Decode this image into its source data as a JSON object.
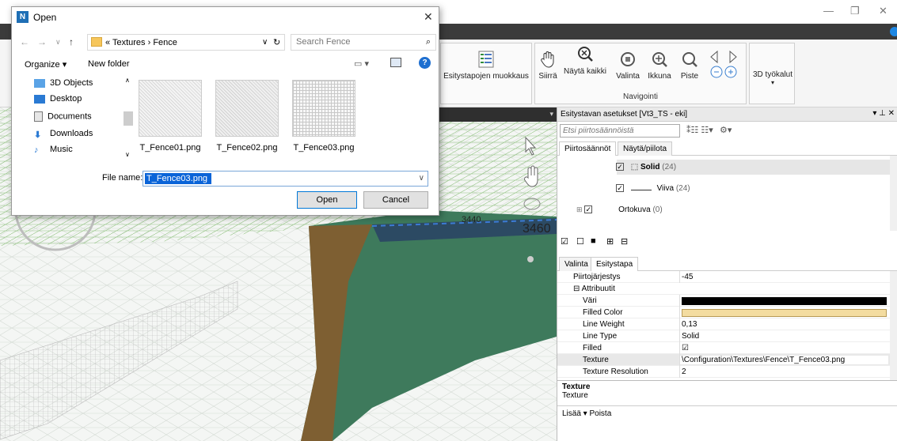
{
  "dialog": {
    "title": "Open",
    "app_icon_letter": "N",
    "breadcrumb": "« Textures › Fence",
    "search_placeholder": "Search Fence",
    "organize_label": "Organize ▾",
    "new_folder_label": "New folder",
    "nav_items": [
      "3D Objects",
      "Desktop",
      "Documents",
      "Downloads",
      "Music"
    ],
    "files": [
      "T_Fence01.png",
      "T_Fence02.png",
      "T_Fence03.png"
    ],
    "file_name_label": "File name:",
    "file_name_value": "T_Fence03.png",
    "open_label": "Open",
    "cancel_label": "Cancel"
  },
  "ribbon": {
    "edit_styles_label": "Esitystapojen muokkaus",
    "move_label": "Siirrä",
    "show_all_label": "Näytä kaikki",
    "select_label": "Valinta",
    "window_label": "Ikkuna",
    "point_label": "Piste",
    "navigation_title": "Navigointi",
    "tools3d_label": "3D työkalut"
  },
  "panel": {
    "title": "Esitystavan asetukset [Vt3_TS - eki]",
    "filter_placeholder": "Etsi piirtosäännöistä",
    "tabs_top": [
      "Piirtosäännöt",
      "Näytä/piilota"
    ],
    "tree": [
      {
        "label": "Solid",
        "count": "(24)"
      },
      {
        "label": "Viiva",
        "count": "(24)"
      },
      {
        "label": "Ortokuva",
        "count": "(0)"
      }
    ],
    "tabs_bottom": [
      "Valinta",
      "Esitystapa"
    ],
    "properties": [
      {
        "name": "Piirtojärjestys",
        "value": "-45"
      },
      {
        "name": "⊟ Attribuutit",
        "value": ""
      },
      {
        "name": "Väri",
        "value": ""
      },
      {
        "name": "Filled Color",
        "value": ""
      },
      {
        "name": "Line Weight",
        "value": "0,13"
      },
      {
        "name": "Line Type",
        "value": "Solid"
      },
      {
        "name": "Filled",
        "value": "☑"
      },
      {
        "name": "Texture",
        "value": "\\Configuration\\Textures\\Fence\\T_Fence03.png"
      },
      {
        "name": "Texture Resolution",
        "value": "2"
      }
    ],
    "desc_title": "Texture",
    "desc_text": "Texture",
    "bottom_actions": "Lisää ▾  Poista"
  },
  "viewport": {
    "station_labels": [
      "3440",
      "3460"
    ]
  },
  "colors": {
    "dialog_accent": "#0078d7",
    "black_swatch": "#000000",
    "filled_swatch": "#f3dca0",
    "terrain_green": "#3e7a5c",
    "embankment_brown": "#8a5a2a"
  }
}
